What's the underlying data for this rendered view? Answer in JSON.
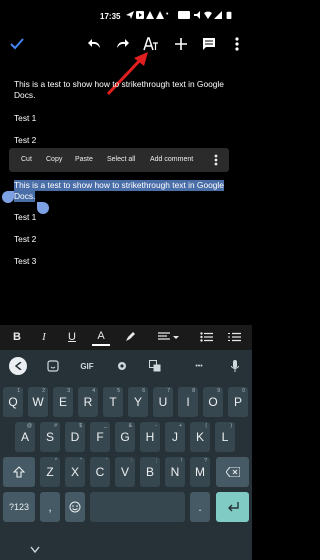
{
  "status": {
    "time": "17:35"
  },
  "toolbar": {
    "done": "done-check",
    "undo": "undo",
    "redo": "redo",
    "text_format": "text-format",
    "add": "add",
    "comment": "comment"
  },
  "document": {
    "lines": [
      "This is a test to show how to strikethrough text in Google",
      "Docs.",
      "Test 1",
      "Test 2",
      "This is a test to show how to strikethrough text in Google",
      "Docs.",
      "Test 1",
      "Test 2",
      "Test 3"
    ]
  },
  "context_menu": {
    "cut": "Cut",
    "copy": "Copy",
    "paste": "Paste",
    "select_all": "Select all",
    "add_comment": "Add comment"
  },
  "format_bar": {
    "bold": "B",
    "italic": "I",
    "underline": "U",
    "text_color": "A"
  },
  "keyboard": {
    "gif": "GIF",
    "more": "•••",
    "row1": [
      "Q",
      "W",
      "E",
      "R",
      "T",
      "Y",
      "U",
      "I",
      "O",
      "P"
    ],
    "row1_hints": [
      "1",
      "2",
      "3",
      "4",
      "5",
      "6",
      "7",
      "8",
      "9",
      "0"
    ],
    "row2": [
      "A",
      "S",
      "D",
      "F",
      "G",
      "H",
      "J",
      "K",
      "L"
    ],
    "row2_hints": [
      "@",
      "#",
      "$",
      "_",
      "&",
      "-",
      "+",
      "(",
      ")"
    ],
    "row3": [
      "Z",
      "X",
      "C",
      "V",
      "B",
      "N",
      "M"
    ],
    "row3_hints": [
      "*",
      "\"",
      "'",
      ":",
      ";",
      "!",
      "?"
    ],
    "sym": "?123",
    "comma": ",",
    "period": ".",
    "ok_icon": "enter"
  },
  "colors": {
    "selection": "#4a6ea8",
    "accent": "#4285f4",
    "arrow": "#e02020",
    "keyboard_bg": "#263238",
    "enter_key": "#80cbc4"
  }
}
